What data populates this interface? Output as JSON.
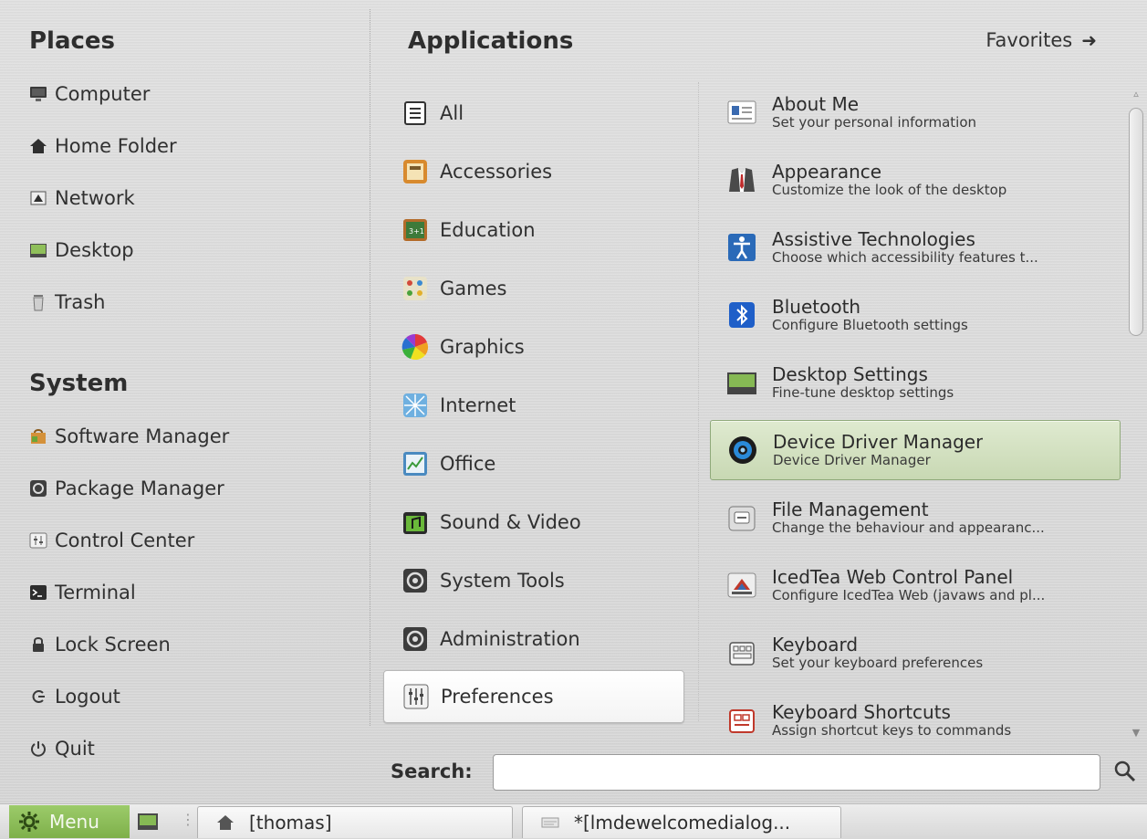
{
  "places": {
    "heading": "Places",
    "items": [
      {
        "label": "Computer"
      },
      {
        "label": "Home Folder"
      },
      {
        "label": "Network"
      },
      {
        "label": "Desktop"
      },
      {
        "label": "Trash"
      }
    ]
  },
  "system": {
    "heading": "System",
    "items": [
      {
        "label": "Software Manager"
      },
      {
        "label": "Package Manager"
      },
      {
        "label": "Control Center"
      },
      {
        "label": "Terminal"
      },
      {
        "label": "Lock Screen"
      },
      {
        "label": "Logout"
      },
      {
        "label": "Quit"
      }
    ]
  },
  "applications": {
    "heading": "Applications",
    "favorites_label": "Favorites",
    "categories": [
      {
        "label": "All"
      },
      {
        "label": "Accessories"
      },
      {
        "label": "Education"
      },
      {
        "label": "Games"
      },
      {
        "label": "Graphics"
      },
      {
        "label": "Internet"
      },
      {
        "label": "Office"
      },
      {
        "label": "Sound & Video"
      },
      {
        "label": "System Tools"
      },
      {
        "label": "Administration"
      },
      {
        "label": "Preferences"
      }
    ],
    "selected_category": "Preferences",
    "apps": [
      {
        "name": "About Me",
        "desc": "Set your personal information"
      },
      {
        "name": "Appearance",
        "desc": "Customize the look of the desktop"
      },
      {
        "name": "Assistive Technologies",
        "desc": "Choose which accessibility features t..."
      },
      {
        "name": "Bluetooth",
        "desc": "Configure Bluetooth settings"
      },
      {
        "name": "Desktop Settings",
        "desc": "Fine-tune desktop settings"
      },
      {
        "name": "Device Driver Manager",
        "desc": "Device Driver Manager"
      },
      {
        "name": "File Management",
        "desc": "Change the behaviour and appearanc..."
      },
      {
        "name": "IcedTea Web Control Panel",
        "desc": "Configure IcedTea Web (javaws and pl..."
      },
      {
        "name": "Keyboard",
        "desc": "Set your keyboard preferences"
      },
      {
        "name": "Keyboard Shortcuts",
        "desc": "Assign shortcut keys to commands"
      }
    ],
    "selected_app": "Device Driver Manager"
  },
  "search": {
    "label": "Search:",
    "value": ""
  },
  "panel": {
    "menu_label": "Menu",
    "windows": [
      {
        "title": "[thomas]"
      },
      {
        "title": "*[lmdewelcomedialog..."
      }
    ]
  },
  "colors": {
    "menu_green": "#8bbd58",
    "selected_app_bg": "#d3e1c1"
  }
}
